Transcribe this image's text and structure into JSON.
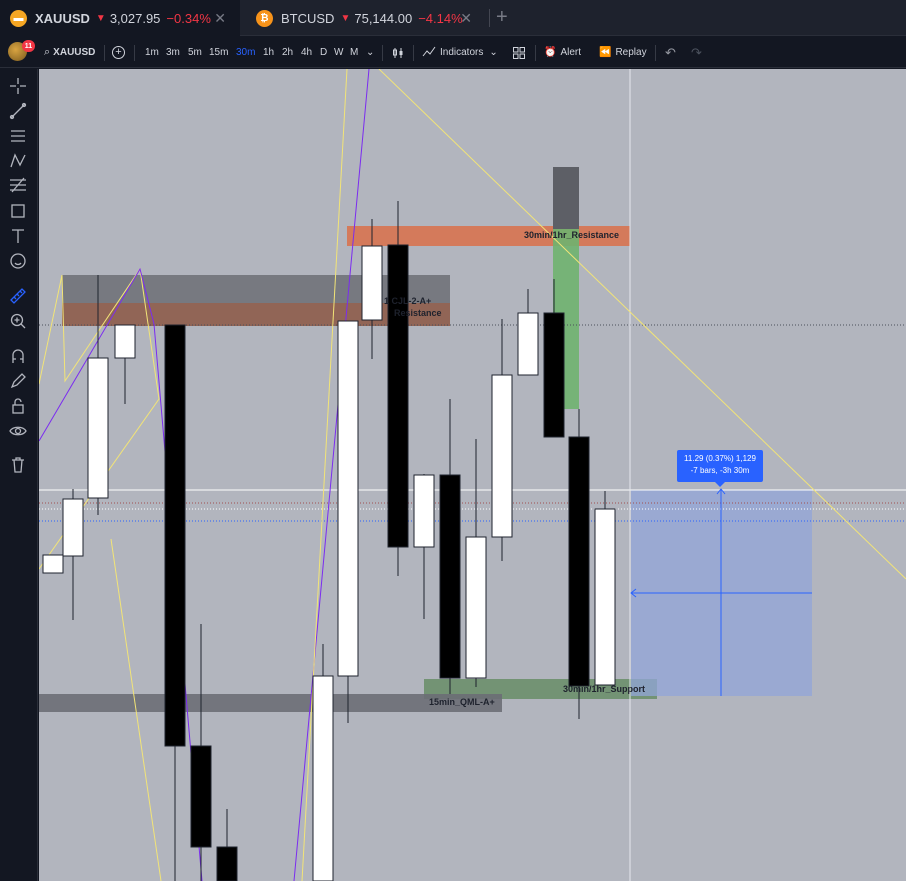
{
  "tabs": [
    {
      "symbol": "XAUUSD",
      "price": "3,027.95",
      "change": "−0.34%",
      "icon": "gold-bars-icon",
      "icon_color": "#f5a623"
    },
    {
      "symbol": "BTCUSD",
      "price": "75,144.00",
      "change": "−4.14%",
      "icon": "bitcoin-icon",
      "icon_color": "#f7931a"
    }
  ],
  "toolbar": {
    "notification_count": "11",
    "symbol": "XAUUSD",
    "timeframes": [
      "1m",
      "3m",
      "5m",
      "15m",
      "30m",
      "1h",
      "2h",
      "4h",
      "D",
      "W",
      "M"
    ],
    "selected_timeframe": "30m",
    "indicators_label": "Indicators",
    "alert_label": "Alert",
    "replay_label": "Replay"
  },
  "zones": {
    "resistance_30m": "30min/1hr_Resistance",
    "cjl_label": "1 CJL-2-A+",
    "resistance_left": "Resistance",
    "support_30m": "30min/1hr_Support",
    "qml_15m": "15min_QML-A+"
  },
  "measure": {
    "line1": "11.29 (0.37%) 1,129",
    "line2": "-7 bars, -3h 30m"
  },
  "colors": {
    "chart_bg": "#b2b5be",
    "resistance_zone": "#d9704a",
    "support_zone": "#6b8f6b",
    "measure_box": "#2962ff",
    "drawing_yellow": "#f2e477",
    "drawing_purple": "#7b2cf0"
  }
}
